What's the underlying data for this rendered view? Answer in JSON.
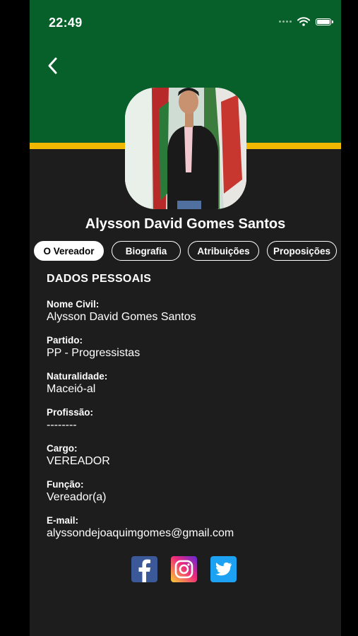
{
  "status_bar": {
    "time": "22:49"
  },
  "profile": {
    "name": "Alysson David Gomes Santos"
  },
  "tabs": [
    {
      "label": "O Vereador"
    },
    {
      "label": "Biografia"
    },
    {
      "label": "Atribuições"
    },
    {
      "label": "Proposições"
    }
  ],
  "section_title": "DADOS PESSOAIS",
  "fields": [
    {
      "label": "Nome Civil:",
      "value": "Alysson David Gomes Santos"
    },
    {
      "label": "Partido:",
      "value": "PP - Progressistas"
    },
    {
      "label": "Naturalidade:",
      "value": "Maceió-al"
    },
    {
      "label": "Profissão:",
      "value": "--------"
    },
    {
      "label": "Cargo:",
      "value": "VEREADOR"
    },
    {
      "label": "Função:",
      "value": "Vereador(a)"
    },
    {
      "label": "E-mail:",
      "value": "alyssondejoaquimgomes@gmail.com"
    }
  ],
  "social": [
    {
      "icon": "facebook-icon",
      "color": "#3b5998"
    },
    {
      "icon": "instagram-icon",
      "color": "#e1306c"
    },
    {
      "icon": "twitter-icon",
      "color": "#1da1f2"
    }
  ],
  "colors": {
    "header": "#07602a",
    "stripe": "#f0b800",
    "background": "#1d1d1d"
  }
}
